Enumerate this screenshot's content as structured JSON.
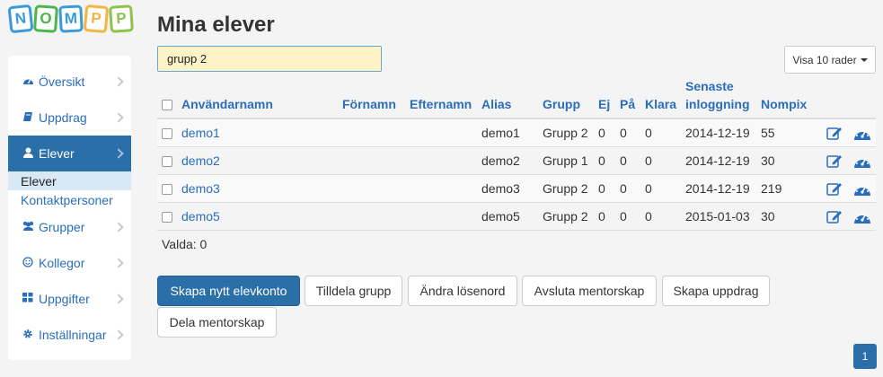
{
  "logo": {
    "letters": [
      "N",
      "O",
      "M",
      "P",
      "P"
    ]
  },
  "sidebar": {
    "items": [
      {
        "label": "Översikt",
        "icon": "dashboard-icon"
      },
      {
        "label": "Uppdrag",
        "icon": "book-icon"
      },
      {
        "label": "Elever",
        "icon": "user-icon",
        "active": true
      },
      {
        "label": "Grupper",
        "icon": "users-icon"
      },
      {
        "label": "Kollegor",
        "icon": "smile-icon"
      },
      {
        "label": "Uppgifter",
        "icon": "grid-icon"
      },
      {
        "label": "Inställningar",
        "icon": "gear-icon"
      }
    ],
    "subitems": [
      {
        "label": "Elever",
        "active": true
      },
      {
        "label": "Kontaktpersoner"
      }
    ]
  },
  "main": {
    "title": "Mina elever",
    "search": {
      "value": "grupp 2",
      "placeholder": ""
    },
    "rows_button": "Visa 10 rader",
    "selected_label": "Valda: 0"
  },
  "table": {
    "headers": {
      "username": "Användarnamn",
      "firstname": "Förnamn",
      "lastname": "Efternamn",
      "alias": "Alias",
      "group": "Grupp",
      "ej": "Ej",
      "pa": "På",
      "klara": "Klara",
      "last_login_1": "Senaste",
      "last_login_2": "inloggning",
      "nompix": "Nompix"
    },
    "rows": [
      {
        "username": "demo1",
        "firstname": "",
        "lastname": "",
        "alias": "demo1",
        "group": "Grupp 2",
        "ej": "0",
        "pa": "0",
        "klara": "0",
        "last_login": "2014-12-19",
        "nompix": "55"
      },
      {
        "username": "demo2",
        "firstname": "",
        "lastname": "",
        "alias": "demo2",
        "group": "Grupp 1",
        "ej": "0",
        "pa": "0",
        "klara": "0",
        "last_login": "2014-12-19",
        "nompix": "30"
      },
      {
        "username": "demo3",
        "firstname": "",
        "lastname": "",
        "alias": "demo3",
        "group": "Grupp 2",
        "ej": "0",
        "pa": "0",
        "klara": "0",
        "last_login": "2014-12-19",
        "nompix": "219"
      },
      {
        "username": "demo5",
        "firstname": "",
        "lastname": "",
        "alias": "demo5",
        "group": "Grupp 2",
        "ej": "0",
        "pa": "0",
        "klara": "0",
        "last_login": "2015-01-03",
        "nompix": "30"
      }
    ]
  },
  "actions": {
    "create": "Skapa nytt elevkonto",
    "assign_group": "Tilldela grupp",
    "change_password": "Ändra lösenord",
    "end_mentorship": "Avsluta mentorskap",
    "create_task": "Skapa uppdrag",
    "share_mentorship": "Dela mentorskap"
  },
  "pagination": {
    "current": "1"
  },
  "colors": {
    "primary": "#2b6fa8",
    "link": "#2a6ebb",
    "search_bg": "#fdf3c6"
  }
}
